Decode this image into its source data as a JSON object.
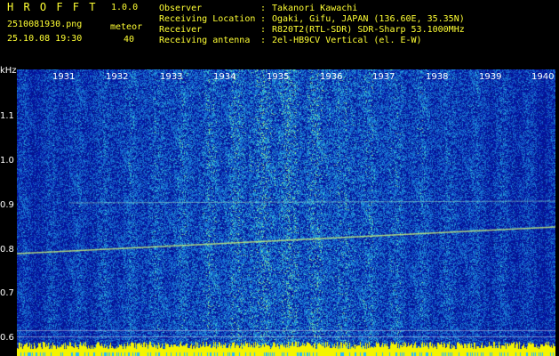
{
  "app": {
    "name": "H R O F F T",
    "version": "1.0.0"
  },
  "file": {
    "name": "2510081930.png",
    "datetime": "25.10.08 19:30"
  },
  "meteor": {
    "label": "meteor",
    "count": "40"
  },
  "info": [
    {
      "key": "Observer",
      "sep": ":",
      "value": "Takanori Kawachi"
    },
    {
      "key": "Receiving Location",
      "sep": ":",
      "value": "Ogaki, Gifu, JAPAN (136.60E, 35.35N)"
    },
    {
      "key": "Receiver",
      "sep": ":",
      "value": "R820T2(RTL-SDR) SDR-Sharp 53.1000MHz"
    },
    {
      "key": "Receiving antenna",
      "sep": ":",
      "value": "2el-HB9CV Vertical (el. E-W)"
    }
  ],
  "yaxis": {
    "unit": "kHz",
    "ticks": [
      "1.1",
      "1.0",
      "0.9",
      "0.8",
      "0.7",
      "0.6"
    ]
  },
  "minutes": [
    "1931",
    "1932",
    "1933",
    "1934",
    "1935",
    "1936",
    "1937",
    "1938",
    "1939",
    "1940"
  ],
  "colors": {
    "label_green": "#33ff33",
    "label_yellow": "#ffff33",
    "noise_blue": "#0a1c9c",
    "signal_yellow": "#f4f400"
  }
}
